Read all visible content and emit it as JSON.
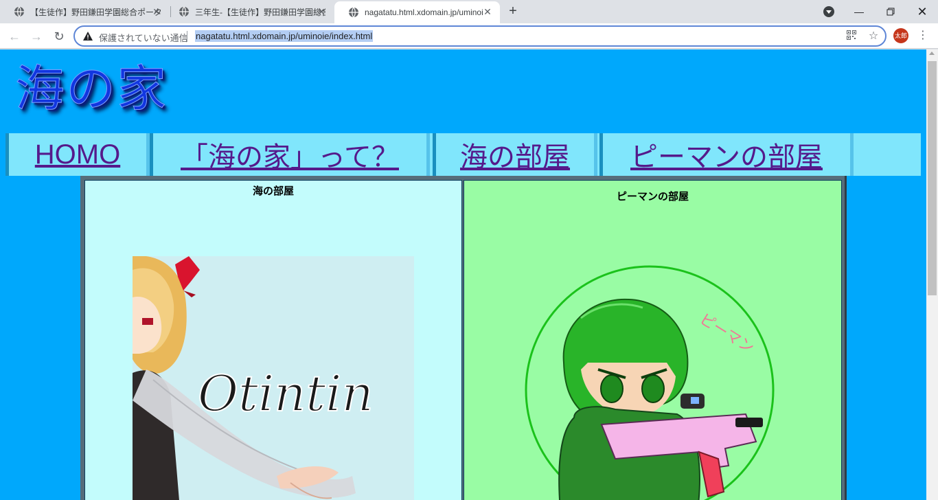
{
  "browser": {
    "tabs": [
      {
        "title": "【生徒作】野田鎌田学園総合ポータル",
        "active": false
      },
      {
        "title": "三年生-【生徒作】野田鎌田学園総合",
        "active": false
      },
      {
        "title": "nagatatu.html.xdomain.jp/uminoie/index.html",
        "active": true
      }
    ],
    "new_tab_icon": "plus-icon",
    "security_text": "保護されていない通信",
    "url": "nagatatu.html.xdomain.jp/uminoie/index.html",
    "profile_initials": "太郎",
    "profile_color": "#c5361b"
  },
  "page": {
    "logo_text": "海の家",
    "nav": [
      "HOMO",
      "「海の家」って？",
      "海の部屋",
      "ピーマンの部屋"
    ],
    "sea_room": {
      "title": "海の部屋",
      "image_text": "Otintin"
    },
    "pepper_room": {
      "title": "ピーマンの部屋",
      "image_text": "ピーマン"
    },
    "colors": {
      "background": "#00a8fc",
      "nav_background": "#80e6fc",
      "sea_room_background": "#c3fcfc",
      "pepper_room_background": "#99fca4",
      "link": "#551a8b"
    }
  }
}
